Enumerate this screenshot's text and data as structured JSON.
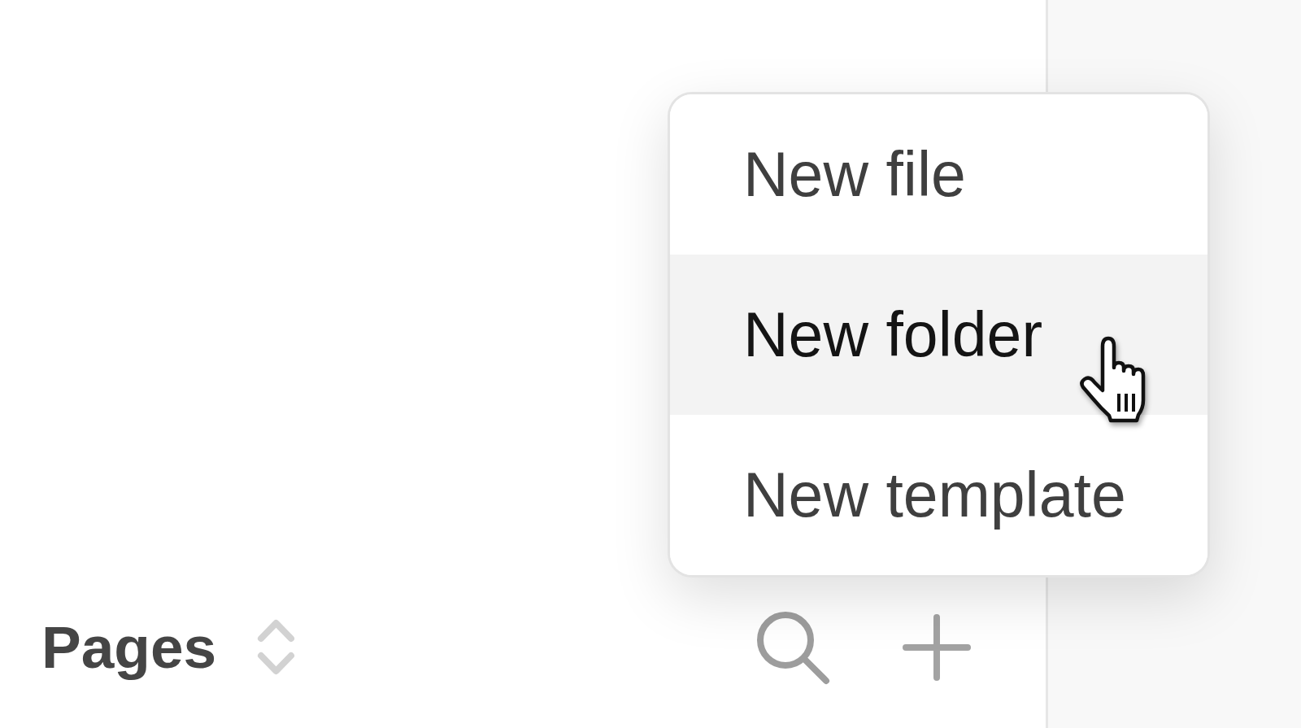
{
  "menu": {
    "items": [
      {
        "label": "New file",
        "hovered": false
      },
      {
        "label": "New folder",
        "hovered": true
      },
      {
        "label": "New template",
        "hovered": false
      }
    ]
  },
  "footer": {
    "title": "Pages"
  }
}
